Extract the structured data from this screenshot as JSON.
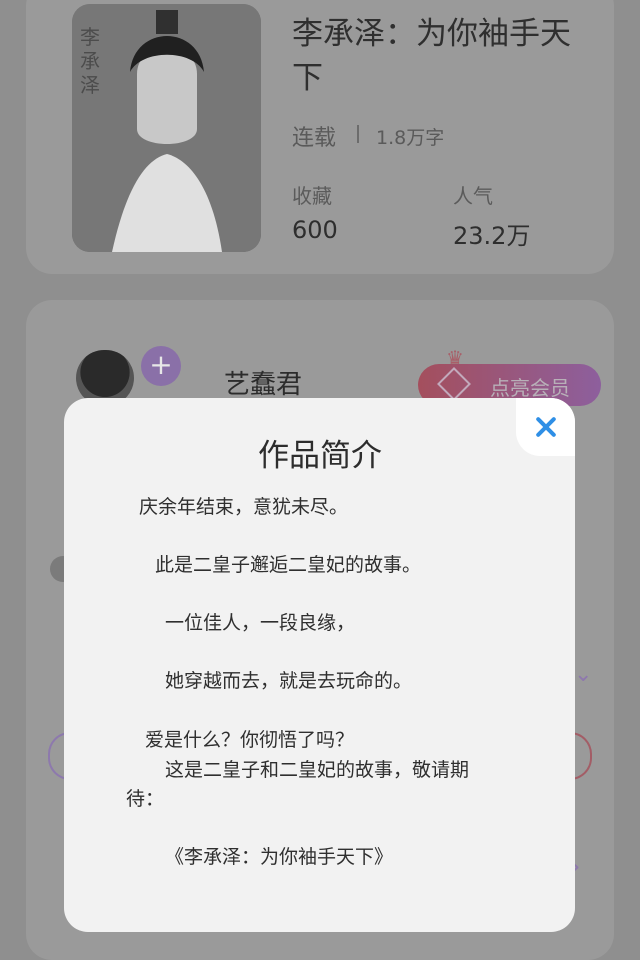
{
  "book": {
    "title": "李承泽：为你袖手天下",
    "status": "连载",
    "word_count": "1.8万字",
    "stats": [
      {
        "label": "收藏",
        "value": "600"
      },
      {
        "label": "人气",
        "value": "23.2万"
      }
    ]
  },
  "author": {
    "name": "艺蠢君",
    "follow_symbol": "+",
    "vip_label": "点亮会员"
  },
  "modal": {
    "title": "作品简介",
    "close_icon": "close-icon",
    "close_color": "#2f8fe6",
    "lines": [
      "庆余年结束，意犹未尽。",
      "此是二皇子邂逅二皇妃的故事。",
      "一位佳人，一段良缘，",
      "她穿越而去，就是去玩命的。",
      "爱是什么？你彻悟了吗？",
      "这是二皇子和二皇妃的故事，敬请期",
      "待：",
      "《李承泽：为你袖手天下》"
    ]
  }
}
